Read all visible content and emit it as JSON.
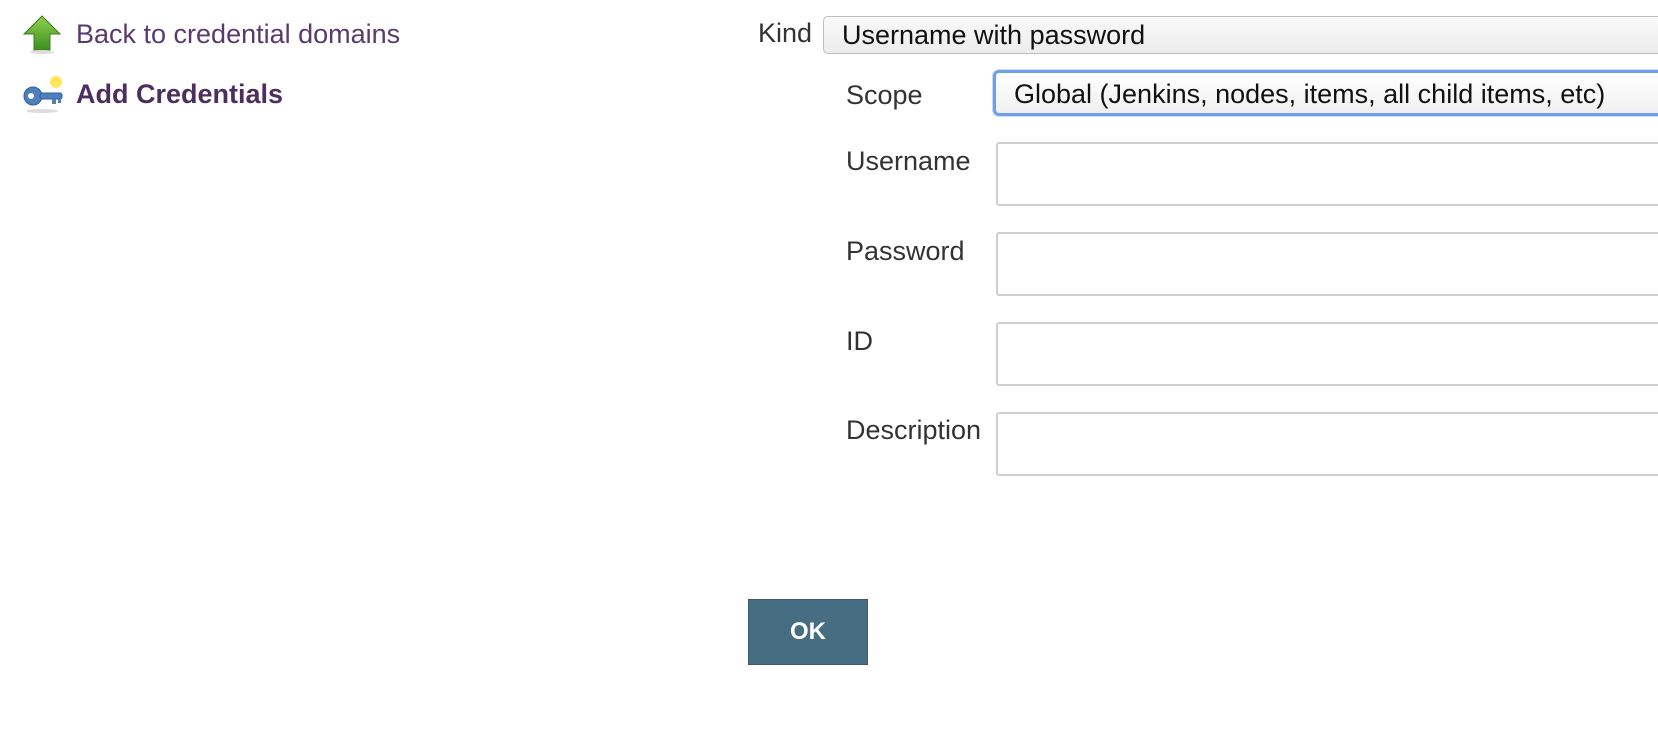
{
  "sidebar": {
    "items": [
      {
        "label": "Back to credential domains",
        "icon": "up-arrow-icon"
      },
      {
        "label": "Add Credentials",
        "icon": "key-icon"
      }
    ]
  },
  "form": {
    "kind": {
      "label": "Kind",
      "value": "Username with password"
    },
    "scope": {
      "label": "Scope",
      "value": "Global (Jenkins, nodes, items, all child items, etc)"
    },
    "username": {
      "label": "Username",
      "value": ""
    },
    "password": {
      "label": "Password",
      "value": ""
    },
    "id": {
      "label": "ID",
      "value": ""
    },
    "description": {
      "label": "Description",
      "value": ""
    },
    "ok_label": "OK"
  },
  "colors": {
    "link": "#5a3a6e",
    "button": "#466d82",
    "focus": "#6f9fea"
  }
}
